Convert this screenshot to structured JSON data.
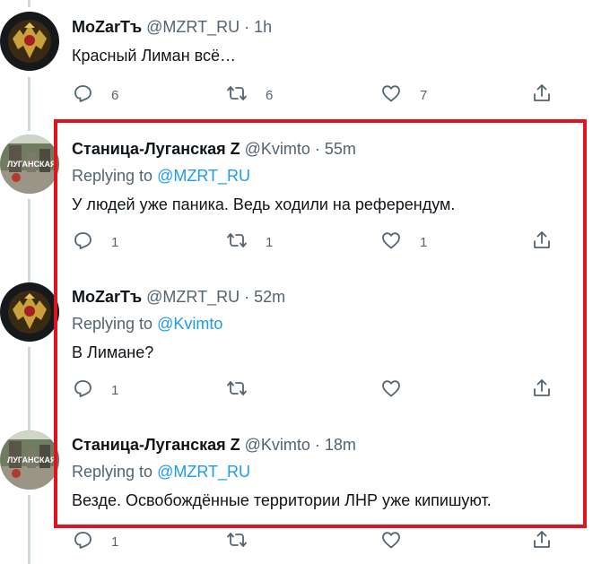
{
  "tweets": [
    {
      "name": "MoZarTъ",
      "meta": "@MZRT_RU · 1h",
      "replying_label": "",
      "replying_handle": "",
      "text": "Красный Лиман всё…",
      "reply_count": "6",
      "retweet_count": "6",
      "like_count": "7"
    },
    {
      "name": "Станица-Луганская Z",
      "meta": "@Kvimto · 55m",
      "replying_label": "Replying to ",
      "replying_handle": "@MZRT_RU",
      "text": "У людей уже паника. Ведь ходили на референдум.",
      "reply_count": "1",
      "retweet_count": "1",
      "like_count": "1"
    },
    {
      "name": "MoZarTъ",
      "meta": "@MZRT_RU · 52m",
      "replying_label": "Replying to ",
      "replying_handle": "@Kvimto",
      "text": "В Лимане?",
      "reply_count": "1",
      "retweet_count": "",
      "like_count": ""
    },
    {
      "name": "Станица-Луганская Z",
      "meta": "@Kvimto · 18m",
      "replying_label": "Replying to ",
      "replying_handle": "@MZRT_RU",
      "text": "Везде. Освобождённые территории ЛНР уже кипишуют.",
      "reply_count": "1",
      "retweet_count": "",
      "like_count": ""
    }
  ],
  "icons": {
    "reply": "reply-icon",
    "retweet": "retweet-icon",
    "like": "heart-icon",
    "share": "share-icon"
  },
  "colors": {
    "link": "#1d9bf0",
    "secondary": "#536471",
    "highlight_border": "#e0141e",
    "thread_line": "#cfd9de"
  }
}
